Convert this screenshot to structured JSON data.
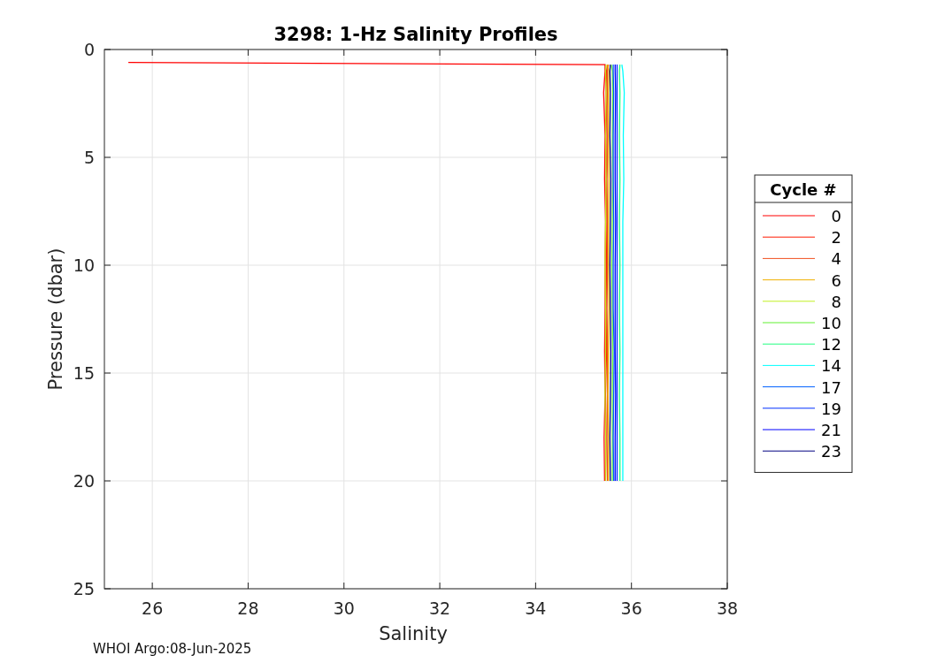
{
  "figure": {
    "footer": "WHOI Argo:08-Jun-2025",
    "chart_data": {
      "type": "line",
      "title": "3298: 1-Hz Salinity Profiles",
      "xlabel": "Salinity",
      "ylabel": "Pressure (dbar)",
      "orientation": "horizontal",
      "x": [
        0.6,
        0.7,
        1,
        2,
        4,
        6,
        8,
        10,
        12,
        14,
        16,
        18,
        20
      ],
      "xlim": [
        25,
        38
      ],
      "ylim": [
        25,
        0
      ],
      "xticks": [
        26,
        28,
        30,
        32,
        34,
        36,
        38
      ],
      "yticks": [
        0,
        5,
        10,
        15,
        20,
        25
      ],
      "grid": true,
      "legend": {
        "title": "Cycle #"
      },
      "series": [
        {
          "name": "0",
          "color": "#ff0000",
          "values": [
            25.5,
            35.45,
            35.45,
            35.42,
            35.45,
            35.44,
            35.46,
            35.45,
            35.45,
            35.44,
            35.45,
            35.43,
            35.44
          ]
        },
        {
          "name": "2",
          "color": "#ff1a00",
          "values": [
            null,
            35.5,
            35.48,
            35.47,
            35.49,
            35.48,
            35.47,
            35.48,
            35.47,
            35.48,
            35.46,
            35.47,
            35.46
          ]
        },
        {
          "name": "4",
          "color": "#f05020",
          "values": [
            null,
            35.52,
            35.5,
            35.5,
            35.51,
            35.49,
            35.5,
            35.5,
            35.49,
            35.5,
            35.5,
            35.49,
            35.5
          ]
        },
        {
          "name": "6",
          "color": "#f0b000",
          "values": [
            null,
            35.5,
            35.53,
            35.52,
            35.52,
            35.53,
            35.52,
            35.52,
            35.53,
            35.52,
            35.51,
            35.52,
            35.52
          ]
        },
        {
          "name": "8",
          "color": "#c0f020",
          "values": [
            null,
            35.47,
            35.46,
            35.47,
            35.46,
            35.47,
            35.46,
            35.45,
            35.46,
            35.46,
            35.45,
            35.46,
            35.46
          ]
        },
        {
          "name": "10",
          "color": "#60f030",
          "values": [
            null,
            35.58,
            35.6,
            35.61,
            35.6,
            35.61,
            35.6,
            35.59,
            35.6,
            35.61,
            35.6,
            35.6,
            35.6
          ]
        },
        {
          "name": "12",
          "color": "#20ff80",
          "values": [
            null,
            35.76,
            35.75,
            35.76,
            35.75,
            35.76,
            35.75,
            35.76,
            35.75,
            35.76,
            35.75,
            35.76,
            35.76
          ]
        },
        {
          "name": "14",
          "color": "#00ffff",
          "values": [
            null,
            35.8,
            35.82,
            35.85,
            35.83,
            35.84,
            35.82,
            35.82,
            35.82,
            35.82,
            35.82,
            35.82,
            35.82
          ]
        },
        {
          "name": "17",
          "color": "#0060ff",
          "values": [
            null,
            35.62,
            35.62,
            35.63,
            35.62,
            35.62,
            35.63,
            35.62,
            35.62,
            35.64,
            35.63,
            35.62,
            35.63
          ]
        },
        {
          "name": "19",
          "color": "#0030ff",
          "values": [
            null,
            35.7,
            35.7,
            35.7,
            35.7,
            35.7,
            35.7,
            35.7,
            35.7,
            35.7,
            35.7,
            35.7,
            35.7
          ]
        },
        {
          "name": "21",
          "color": "#0000ff",
          "values": [
            null,
            35.66,
            35.66,
            35.67,
            35.66,
            35.66,
            35.67,
            35.66,
            35.66,
            35.66,
            35.67,
            35.66,
            35.66
          ]
        },
        {
          "name": "23",
          "color": "#000080",
          "values": [
            null,
            35.56,
            35.55,
            35.56,
            35.55,
            35.57,
            35.56,
            35.55,
            35.56,
            35.57,
            35.56,
            35.55,
            35.56
          ]
        }
      ]
    }
  }
}
